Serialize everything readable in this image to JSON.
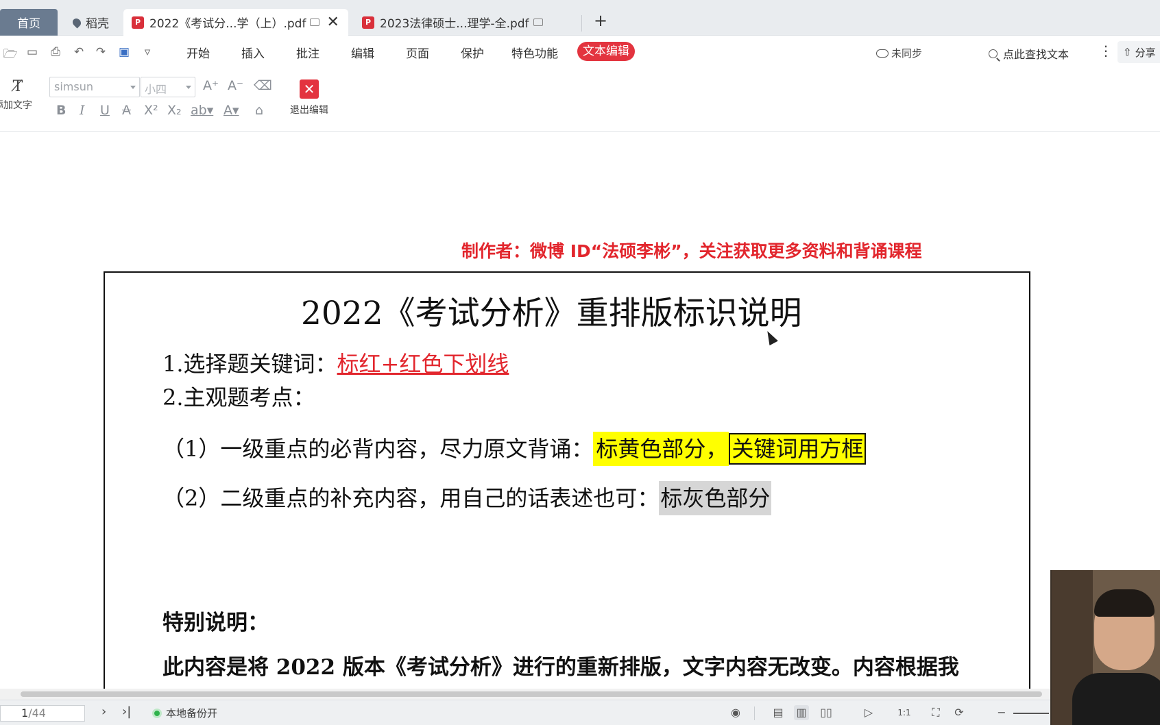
{
  "tabs": {
    "home": "首页",
    "daoke": "稻壳",
    "active": "2022《考试分...学（上）.pdf",
    "second": "2023法律硕士...理学-全.pdf",
    "add": "+"
  },
  "menu": {
    "items": [
      "开始",
      "插入",
      "批注",
      "编辑",
      "页面",
      "保护",
      "特色功能"
    ],
    "active": "文本编辑",
    "sync": "未同步",
    "search": "点此查找文本",
    "share": "分享"
  },
  "toolbar": {
    "add_text": "添加文字",
    "font": "simsun",
    "size": "小四",
    "exit_edit": "退出编辑"
  },
  "document": {
    "author_line": "制作者：微博 ID“法硕李彬”，关注获取更多资料和背诵课程",
    "title": "2022《考试分析》重排版标识说明",
    "item1_prefix": "1.选择题关键词：",
    "item1_red": "标红+红色下划线",
    "item2": "2.主观题考点：",
    "sub1_prefix": "（1）一级重点的必背内容，尽力原文背诵：",
    "sub1_yellow": "标黄色部分，",
    "sub1_box": "关键词用方框",
    "sub2_prefix": "（2）二级重点的补充内容，用自己的话表述也可：",
    "sub2_gray": "标灰色部分",
    "special_heading": "特别说明：",
    "special_text": "此内容是将 2022 版本《考试分析》进行的重新排版，文字内容无改变。内容根据我"
  },
  "status": {
    "page_current": "1",
    "page_total": "/44",
    "backup": "本地备份开"
  },
  "colors": {
    "accent_red": "#e3343f",
    "highlight_yellow": "#ffff00",
    "highlight_gray": "#d6d6d6",
    "backup_green": "#2fb24c"
  }
}
